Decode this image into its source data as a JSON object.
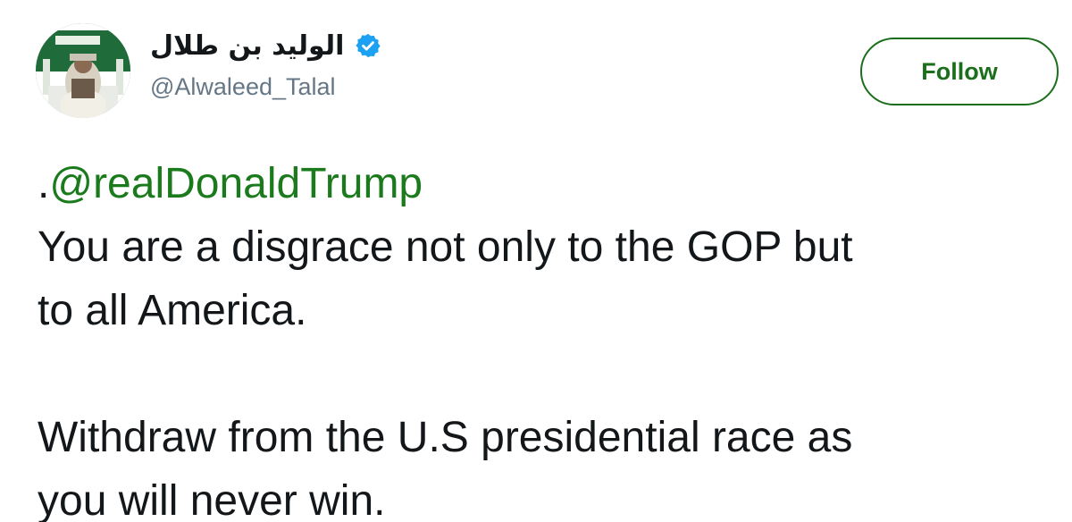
{
  "user": {
    "display_name": "الوليد بن طلال",
    "handle": "@Alwaleed_Talal",
    "verified_icon": "verified-badge-icon"
  },
  "follow_button": {
    "label": "Follow"
  },
  "tweet": {
    "prefix": ".",
    "mention": "@realDonaldTrump",
    "line1": "You are a disgrace not only to the GOP but",
    "line2": "to all America.",
    "line3": "Withdraw from the U.S presidential race as",
    "line4": "you will never win."
  },
  "colors": {
    "accent_green": "#1b7a1b",
    "verified_blue": "#1da1f2",
    "text": "#14171a",
    "secondary_text": "#657786"
  }
}
